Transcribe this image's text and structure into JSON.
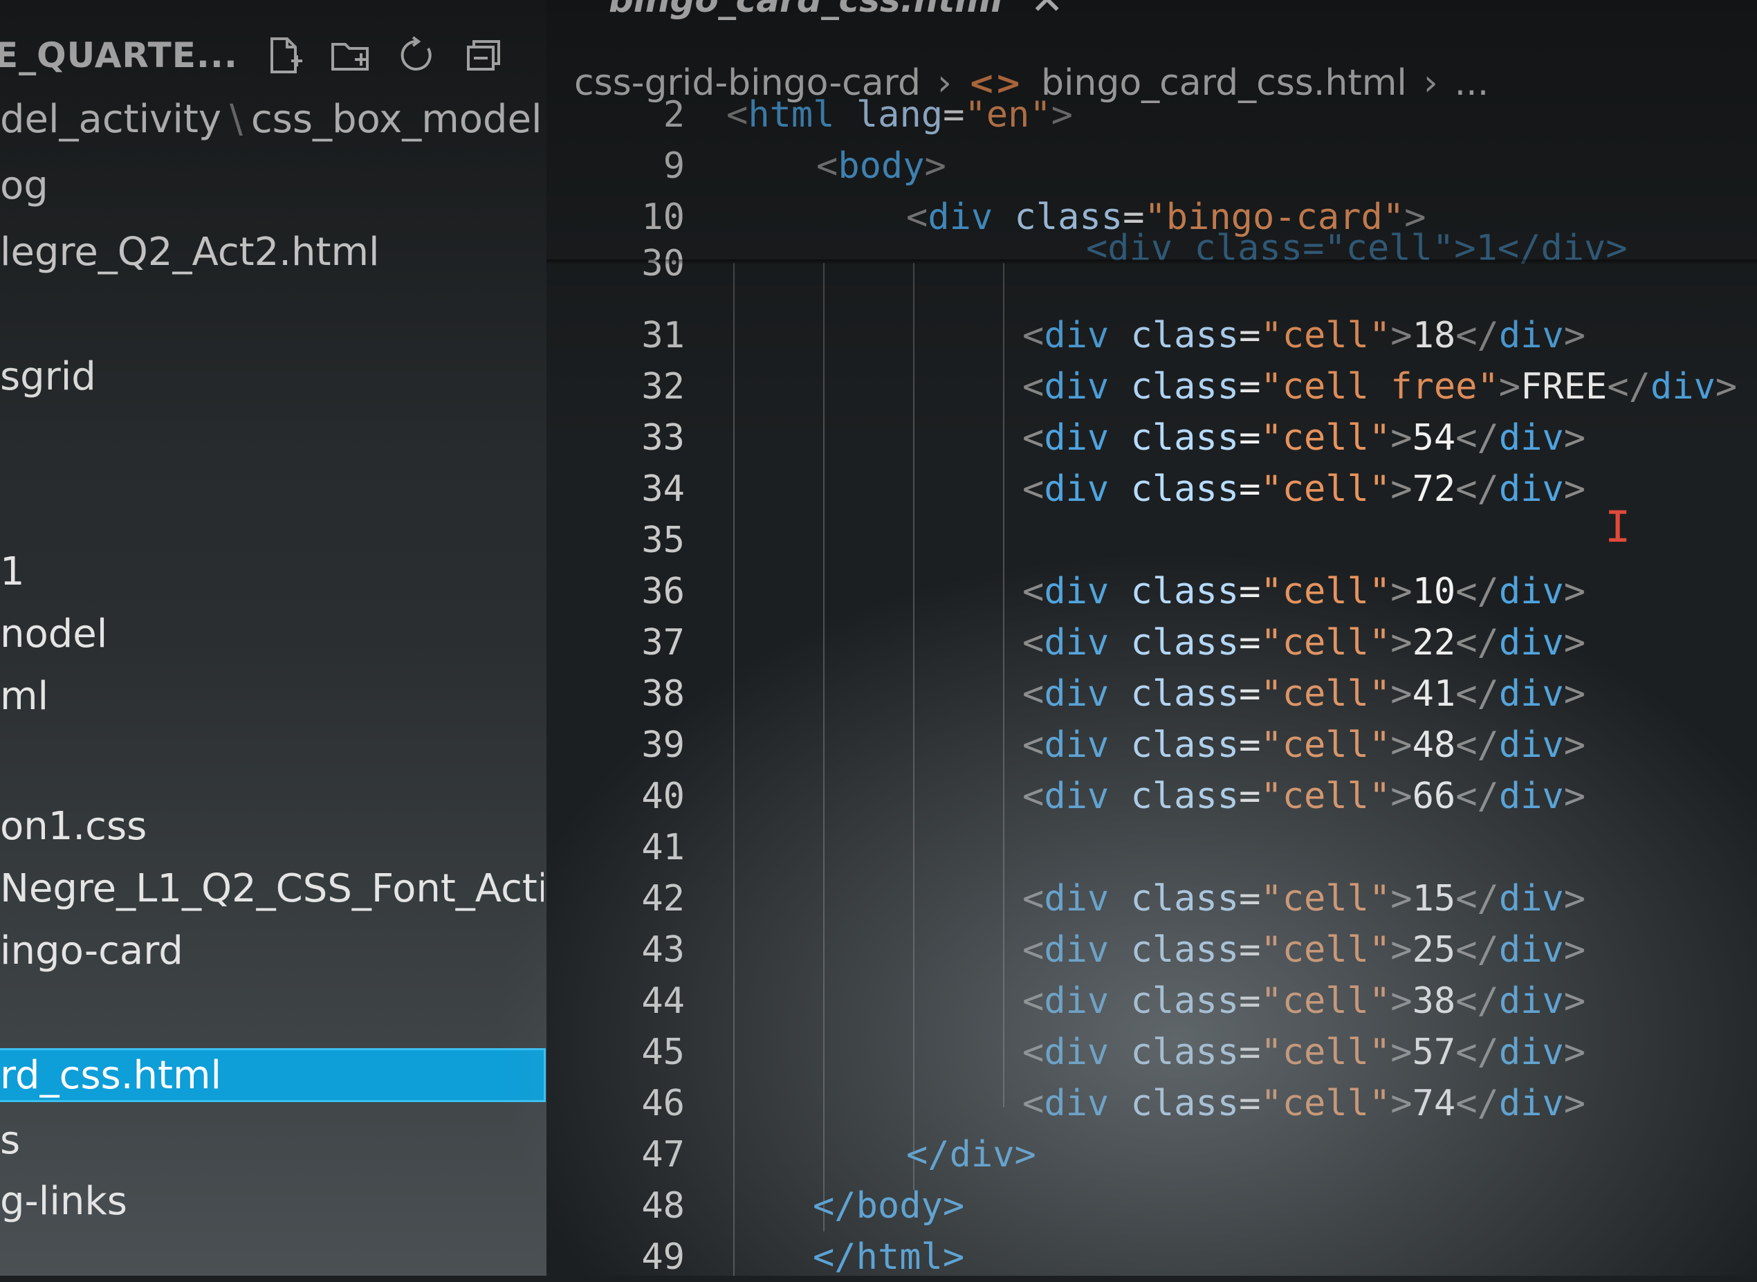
{
  "tab": {
    "title": "bingo_card_css.html",
    "close_glyph": "✕"
  },
  "explorer": {
    "title": "E_QUARTE...",
    "tools": [
      {
        "name": "new-file-icon"
      },
      {
        "name": "new-folder-icon"
      },
      {
        "name": "refresh-icon"
      },
      {
        "name": "collapse-all-icon"
      }
    ],
    "items": [
      {
        "label": "del_activity",
        "label2": "css_box_model..."
      },
      {
        "label": "og"
      },
      {
        "label": "legre_Q2_Act2.html"
      },
      {
        "label": "sgrid"
      },
      {
        "label": "1"
      },
      {
        "label": "nodel"
      },
      {
        "label": "ml"
      },
      {
        "label": "on1.css"
      },
      {
        "label": "Negre_L1_Q2_CSS_Font_Acti..."
      },
      {
        "label": "ingo-card"
      },
      {
        "label": "rd_css.html",
        "selected": true
      },
      {
        "label": "s"
      },
      {
        "label": "g-links"
      }
    ]
  },
  "breadcrumb": {
    "folder": "css-grid-bingo-card",
    "file_icon": "<>",
    "file": "bingo_card_css.html",
    "ellipsis": "..."
  },
  "editor": {
    "sticky": [
      {
        "ln": "2",
        "indent": 0,
        "parts": [
          "<",
          "html",
          " ",
          "lang",
          "=",
          "\"en\"",
          ">"
        ]
      },
      {
        "ln": "9",
        "indent": 1,
        "parts": [
          "<",
          "body",
          ">"
        ]
      },
      {
        "ln": "10",
        "indent": 2,
        "parts": [
          "<",
          "div",
          " ",
          "class",
          "=",
          "\"bingo-card\"",
          ">"
        ]
      }
    ],
    "lines": [
      {
        "ln": "30",
        "code": "<div class=\"cell\">1</div>",
        "partial": true
      },
      {
        "ln": "31",
        "cls": "\"cell\"",
        "text": "18"
      },
      {
        "ln": "32",
        "cls": "\"cell free\"",
        "text": "FREE"
      },
      {
        "ln": "33",
        "cls": "\"cell\"",
        "text": "54"
      },
      {
        "ln": "34",
        "cls": "\"cell\"",
        "text": "72"
      },
      {
        "ln": "35",
        "blank": true
      },
      {
        "ln": "36",
        "cls": "\"cell\"",
        "text": "10"
      },
      {
        "ln": "37",
        "cls": "\"cell\"",
        "text": "22"
      },
      {
        "ln": "38",
        "cls": "\"cell\"",
        "text": "41"
      },
      {
        "ln": "39",
        "cls": "\"cell\"",
        "text": "48"
      },
      {
        "ln": "40",
        "cls": "\"cell\"",
        "text": "66"
      },
      {
        "ln": "41",
        "blank": true
      },
      {
        "ln": "42",
        "cls": "\"cell\"",
        "text": "15"
      },
      {
        "ln": "43",
        "cls": "\"cell\"",
        "text": "25"
      },
      {
        "ln": "44",
        "cls": "\"cell\"",
        "text": "38"
      },
      {
        "ln": "45",
        "cls": "\"cell\"",
        "text": "57"
      },
      {
        "ln": "46",
        "cls": "\"cell\"",
        "text": "74"
      },
      {
        "ln": "47",
        "close": "</div>"
      },
      {
        "ln": "48",
        "close": "</body>"
      },
      {
        "ln": "49",
        "close": "</html>"
      }
    ],
    "div_tag": "div",
    "class_attr": "class",
    "text_cursor_glyph": "I"
  }
}
